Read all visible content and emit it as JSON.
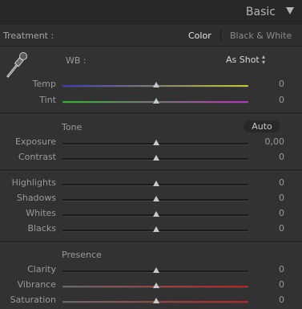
{
  "header": {
    "title": "Basic",
    "collapse_icon": "triangle-down-icon"
  },
  "treatment": {
    "label": "Treatment :",
    "options": [
      "Color",
      "Black & White"
    ],
    "selected": "Color"
  },
  "wb": {
    "label": "WB :",
    "value": "As Shot",
    "picker_icon": "eyedropper-icon"
  },
  "wb_sliders": [
    {
      "label": "Temp",
      "value": "0",
      "gradient": [
        "#3a3ab8",
        "#c8c830"
      ]
    },
    {
      "label": "Tint",
      "value": "0",
      "gradient": [
        "#30b830",
        "#c030c0"
      ]
    }
  ],
  "tone": {
    "title": "Tone",
    "auto_label": "Auto",
    "sliders": [
      {
        "label": "Exposure",
        "value": "0,00"
      },
      {
        "label": "Contrast",
        "value": "0"
      }
    ]
  },
  "tone_detail_sliders": [
    {
      "label": "Highlights",
      "value": "0"
    },
    {
      "label": "Shadows",
      "value": "0"
    },
    {
      "label": "Whites",
      "value": "0"
    },
    {
      "label": "Blacks",
      "value": "0"
    }
  ],
  "presence": {
    "title": "Presence",
    "sliders": [
      {
        "label": "Clarity",
        "value": "0"
      },
      {
        "label": "Vibrance",
        "value": "0",
        "gradient": [
          "#6a6a6a",
          "#c02020"
        ]
      },
      {
        "label": "Saturation",
        "value": "0",
        "gradient": [
          "#6a6a6a",
          "#c02020"
        ]
      }
    ]
  }
}
